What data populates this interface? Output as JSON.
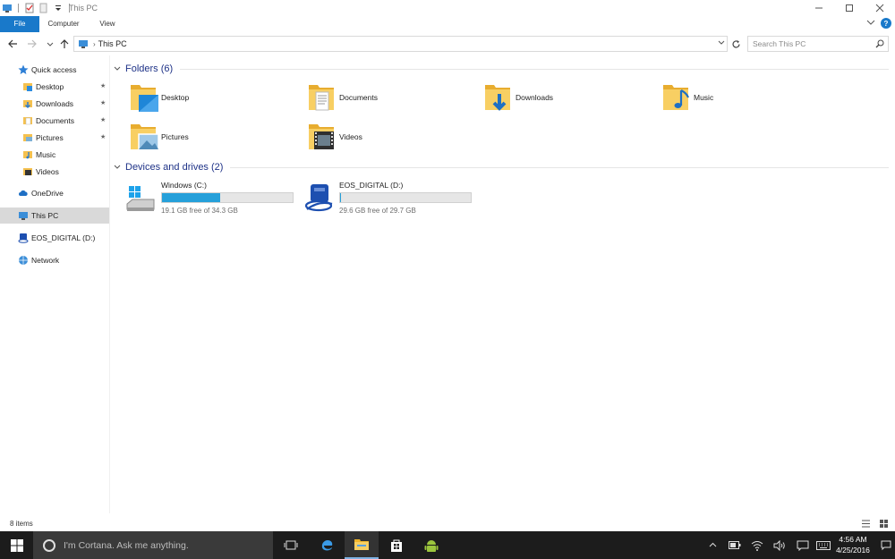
{
  "window": {
    "title": "This PC"
  },
  "ribbon": {
    "tabs": [
      "File",
      "Computer",
      "View"
    ],
    "help": "?"
  },
  "address": {
    "crumb": "This PC",
    "search_placeholder": "Search This PC"
  },
  "nav": {
    "items": [
      {
        "label": "Quick access",
        "icon": "star-icon"
      },
      {
        "label": "Desktop",
        "icon": "desktop-folder-icon",
        "pinned": true
      },
      {
        "label": "Downloads",
        "icon": "downloads-folder-icon",
        "pinned": true
      },
      {
        "label": "Documents",
        "icon": "documents-folder-icon",
        "pinned": true
      },
      {
        "label": "Pictures",
        "icon": "pictures-folder-icon",
        "pinned": true
      },
      {
        "label": "Music",
        "icon": "music-folder-icon"
      },
      {
        "label": "Videos",
        "icon": "videos-folder-icon"
      },
      {
        "label": "OneDrive",
        "icon": "cloud-icon"
      },
      {
        "label": "This PC",
        "icon": "computer-icon",
        "selected": true
      },
      {
        "label": "EOS_DIGITAL (D:)",
        "icon": "drive-icon"
      },
      {
        "label": "Network",
        "icon": "network-icon"
      }
    ]
  },
  "groups": {
    "folders_title": "Folders (6)",
    "drives_title": "Devices and drives (2)"
  },
  "folders": [
    {
      "label": "Desktop",
      "icon": "desktop-folder-icon"
    },
    {
      "label": "Documents",
      "icon": "documents-folder-icon"
    },
    {
      "label": "Downloads",
      "icon": "downloads-folder-icon"
    },
    {
      "label": "Music",
      "icon": "music-folder-icon"
    },
    {
      "label": "Pictures",
      "icon": "pictures-folder-icon"
    },
    {
      "label": "Videos",
      "icon": "videos-folder-icon"
    }
  ],
  "drives": [
    {
      "name": "Windows (C:)",
      "free": "19.1 GB free of 34.3 GB",
      "used_fraction": 0.443,
      "icon": "windows-drive-icon"
    },
    {
      "name": "EOS_DIGITAL (D:)",
      "free": "29.6 GB free of 29.7 GB",
      "used_fraction": 0.003,
      "icon": "removable-drive-icon"
    }
  ],
  "status": {
    "count": "8 items"
  },
  "taskbar": {
    "cortana": "I'm Cortana. Ask me anything.",
    "time": "4:56 AM",
    "date": "4/25/2016"
  },
  "colors": {
    "accent": "#1979ca",
    "bar": "#26a0da",
    "taskbar": "#1c1c1c",
    "folder": "#f5c14f"
  }
}
